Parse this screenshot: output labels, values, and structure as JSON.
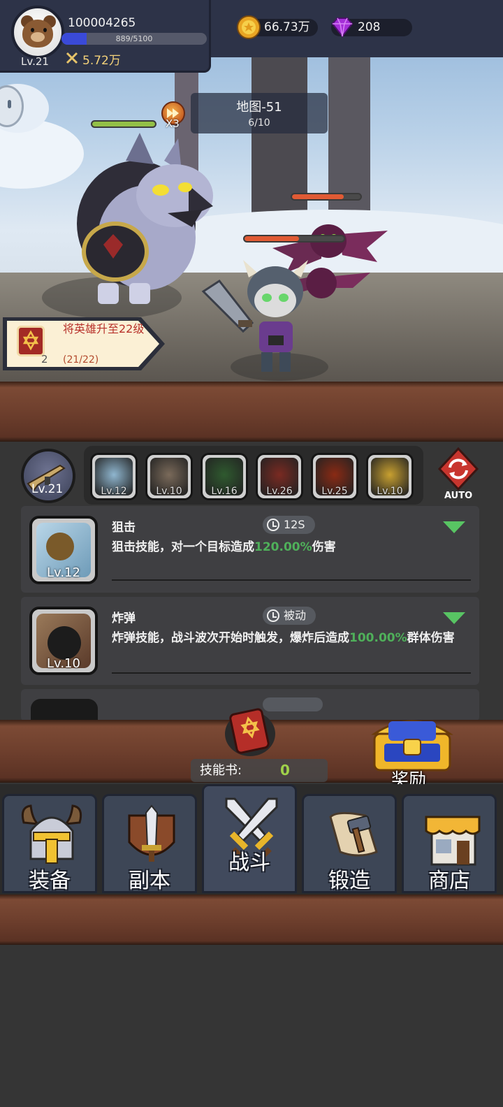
{
  "player": {
    "id": "100004265",
    "level": "Lv.21",
    "xp_text": "889/5100",
    "xp_fraction": 0.174,
    "power": "5.72万",
    "avatar_icon": "bear-icon"
  },
  "currency": {
    "gold": "66.73万",
    "gold_icon": "gold-coin-icon",
    "gems": "208",
    "gem_icon": "purple-gem-icon"
  },
  "battle": {
    "map_name": "地图-51",
    "wave": "6/10",
    "speed_label": "X3",
    "hero_hp_fraction": 1.0,
    "enemy_bat_hp_fraction": 0.75,
    "enemy_skeleton_hp_fraction": 0.55,
    "hp_color_hero": "#93c046",
    "hp_color_enemy": "#e05a34"
  },
  "quest": {
    "title": "将英雄升至22级",
    "progress": "(21/22)",
    "book_count": "2"
  },
  "skill_bar": {
    "weapon_level": "Lv.21",
    "auto_label": "AUTO",
    "slots": [
      {
        "level": "Lv.12",
        "icon": "sniper-skill-icon",
        "color": "#8fb6cf"
      },
      {
        "level": "Lv.10",
        "icon": "bomb-skill-icon",
        "color": "#7a6a5a"
      },
      {
        "level": "Lv.16",
        "icon": "poison-skill-icon",
        "color": "#2f5a2f"
      },
      {
        "level": "Lv.26",
        "icon": "fireball-skill-icon",
        "color": "#7a2a22"
      },
      {
        "level": "Lv.25",
        "icon": "meteor-skill-icon",
        "color": "#8a2a14"
      },
      {
        "level": "Lv.10",
        "icon": "lightning-skill-icon",
        "color": "#c8a030"
      }
    ]
  },
  "skills": [
    {
      "name": "狙击",
      "cooldown": "12S",
      "level": "Lv.12",
      "desc_before": "狙击技能，对一个目标造成",
      "desc_value": "120.00%",
      "desc_after": "伤害"
    },
    {
      "name": "炸弹",
      "cooldown": "被动",
      "level": "Lv.10",
      "desc_before": "炸弹技能，战斗波次开始时触发，爆炸后造成",
      "desc_value": "100.00%",
      "desc_after": "群体伤害"
    }
  ],
  "skill_book": {
    "label": "技能书:",
    "count": "0"
  },
  "reward": {
    "label": "奖励"
  },
  "nav": [
    {
      "label": "装备",
      "icon": "viking-helmet-icon"
    },
    {
      "label": "副本",
      "icon": "sword-shield-icon"
    },
    {
      "label": "战斗",
      "icon": "crossed-swords-icon",
      "active": true
    },
    {
      "label": "锻造",
      "icon": "scroll-hammer-icon"
    },
    {
      "label": "商店",
      "icon": "shop-icon"
    }
  ]
}
